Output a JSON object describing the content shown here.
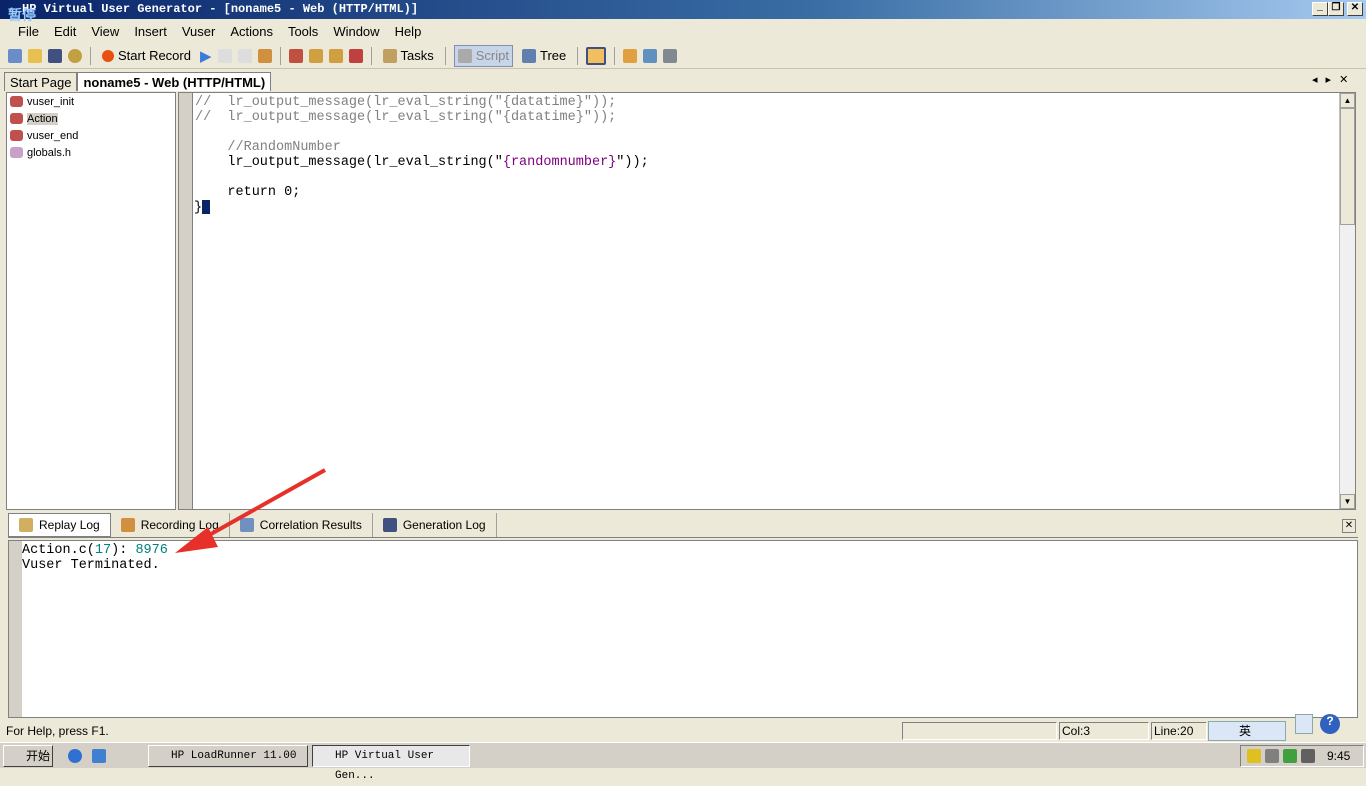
{
  "window": {
    "title": "HP Virtual User Generator - [noname5 - Web (HTTP/HTML)]",
    "overlay_label": "暂停"
  },
  "menu": [
    "File",
    "Edit",
    "View",
    "Insert",
    "Vuser",
    "Actions",
    "Tools",
    "Window",
    "Help"
  ],
  "toolbar": {
    "start_record": "Start Record",
    "tasks": "Tasks",
    "script": "Script",
    "tree": "Tree"
  },
  "tabs": [
    {
      "label": "Start Page"
    },
    {
      "label": "noname5 - Web (HTTP/HTML)",
      "active": true
    }
  ],
  "tree": [
    {
      "label": "vuser_init"
    },
    {
      "label": "Action",
      "selected": true
    },
    {
      "label": "vuser_end"
    },
    {
      "label": "globals.h"
    }
  ],
  "code": {
    "line1": "//  lr_output_message(lr_eval_string(\"{datatime}\"));",
    "line2": "//  lr_output_message(lr_eval_string(\"{datatime}\"));",
    "comment": "    //RandomNumber",
    "call_prefix": "    lr_output_message(lr_eval_string(\"",
    "call_param": "{randomnumber}",
    "call_suffix": "\"));",
    "ret": "    return 0;",
    "brace": "}"
  },
  "bottom_tabs": [
    {
      "label": "Replay Log",
      "active": true
    },
    {
      "label": "Recording Log"
    },
    {
      "label": "Correlation Results"
    },
    {
      "label": "Generation Log"
    }
  ],
  "log": {
    "prefix": "Action.c(",
    "line": "17",
    "mid": "): ",
    "value": "8976",
    "line2": "Vuser Terminated."
  },
  "status": {
    "help": "For Help, press F1.",
    "col": "Col:3",
    "line": "Line:20",
    "ime": "英"
  },
  "taskbar": {
    "start": "开始",
    "tasks": [
      "HP LoadRunner 11.00",
      "HP Virtual User Gen..."
    ],
    "clock": "9:45"
  },
  "colors": {
    "title": "#0a246a",
    "accent_arrow": "#e8302a",
    "log_value": "#008080"
  }
}
